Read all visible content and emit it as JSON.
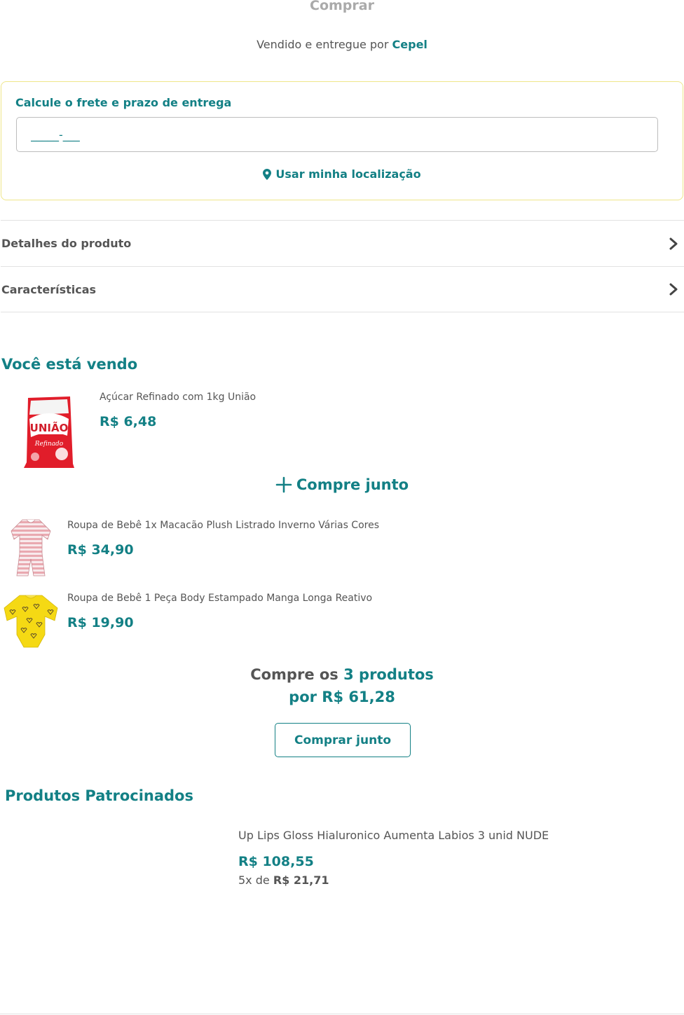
{
  "header": {
    "buy_label": "Comprar",
    "sold_by_prefix": "Vendido e entregue por",
    "seller": "Cepel"
  },
  "shipping": {
    "title": "Calcule o frete e prazo de entrega",
    "cep_placeholder": "_____-___",
    "use_location": "Usar minha localização"
  },
  "accordions": [
    {
      "label": "Detalhes do produto"
    },
    {
      "label": "Características"
    }
  ],
  "selling": {
    "title": "Você está vendo",
    "main_product": {
      "name": "Açúcar Refinado com 1kg União",
      "price": "R$ 6,48",
      "brand_text": "UNIÃO",
      "sub_text": "Refinado"
    }
  },
  "buy_together": {
    "heading": "Compre junto",
    "items": [
      {
        "name": "Roupa de Bebê 1x Macacão Plush Listrado Inverno Várias Cores",
        "price": "R$ 34,90"
      },
      {
        "name": "Roupa de Bebê 1 Peça Body Estampado Manga Longa Reativo",
        "price": "R$ 19,90"
      }
    ],
    "total_prefix": "Compre os",
    "total_count": "3 produtos",
    "total_price": "por R$ 61,28",
    "button_label": "Comprar junto"
  },
  "sponsored": {
    "title": "Produtos Patrocinados",
    "product": {
      "name": "Up Lips Gloss Hialuronico Aumenta Labios 3 unid NUDE",
      "price": "R$ 108,55",
      "installment_prefix": "5x de",
      "installment_value": "R$ 21,71"
    }
  },
  "colors": {
    "accent": "#138085",
    "text": "#555555",
    "muted": "#aaaaaa",
    "box_border": "#efe68a"
  }
}
